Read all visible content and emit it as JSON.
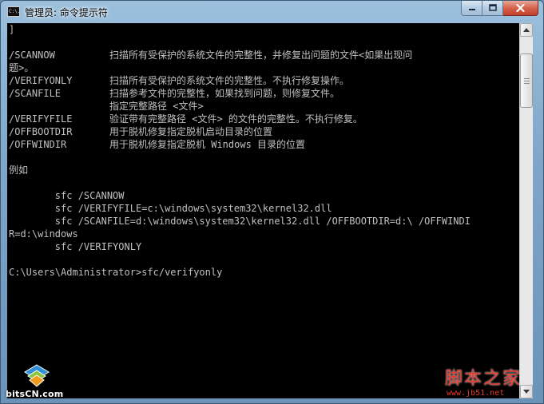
{
  "window": {
    "title": "管理员: 命令提示符",
    "icon": "cmd-app-icon",
    "icon_text": "C:\\."
  },
  "console": {
    "lines": [
      {
        "text": "]"
      },
      {
        "text": ""
      },
      {
        "cmd": "/SCANNOW",
        "desc": "扫描所有受保护的系统文件的完整性，并修复出问题的文件<如果出现问"
      },
      {
        "text": "题>。"
      },
      {
        "cmd": "/VERIFYONLY",
        "desc": "扫描所有受保护的系统文件的完整性。不执行修复操作。"
      },
      {
        "cmd": "/SCANFILE",
        "desc": "扫描参考文件的完整性，如果找到问题，则修复文件。"
      },
      {
        "cmd": "",
        "desc": "指定完整路径 <文件>"
      },
      {
        "cmd": "/VERIFYFILE",
        "desc": "验证带有完整路径 <文件> 的文件的完整性。不执行修复。"
      },
      {
        "cmd": "/OFFBOOTDIR",
        "desc": "用于脱机修复指定脱机启动目录的位置"
      },
      {
        "cmd": "/OFFWINDIR",
        "desc": "用于脱机修复指定脱机 Windows 目录的位置"
      },
      {
        "text": ""
      },
      {
        "text": "例如"
      },
      {
        "text": ""
      },
      {
        "text": "        sfc /SCANNOW"
      },
      {
        "text": "        sfc /VERIFYFILE=c:\\windows\\system32\\kernel32.dll"
      },
      {
        "text": "        sfc /SCANFILE=d:\\windows\\system32\\kernel32.dll /OFFBOOTDIR=d:\\ /OFFWINDI"
      },
      {
        "text": "R=d:\\windows"
      },
      {
        "text": "        sfc /VERIFYONLY"
      },
      {
        "text": ""
      },
      {
        "text": "C:\\Users\\Administrator>sfc/verifyonly"
      }
    ]
  },
  "watermarks": {
    "left_text": "bitsCN.com",
    "right_big": "脚本之家",
    "right_small": "www.jb51.net"
  },
  "colors": {
    "console_bg": "#000000",
    "console_fg": "#c0c0c0",
    "close_red": "#c4402a",
    "wm_red": "#e63a2e"
  }
}
